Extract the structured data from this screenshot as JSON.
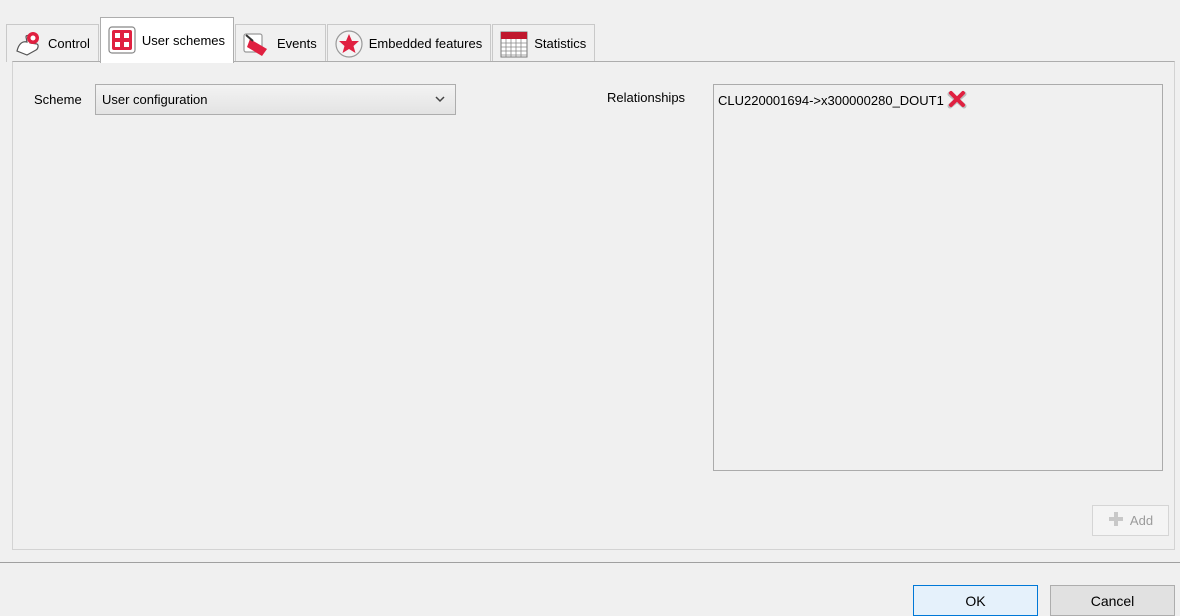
{
  "tabs": [
    {
      "label": "Control",
      "icon": "hand-pointer-icon",
      "active": false
    },
    {
      "label": "User schemes",
      "icon": "user-schemes-icon",
      "active": true
    },
    {
      "label": "Events",
      "icon": "events-icon",
      "active": false
    },
    {
      "label": "Embedded features",
      "icon": "star-badge-icon",
      "active": false
    },
    {
      "label": "Statistics",
      "icon": "calendar-grid-icon",
      "active": false
    }
  ],
  "scheme": {
    "label": "Scheme",
    "selected": "User configuration"
  },
  "relationships": {
    "label": "Relationships",
    "items": [
      {
        "text": "CLU220001694->x300000280_DOUT1",
        "icon": "delete-x-icon"
      }
    ],
    "add_label": "Add",
    "add_icon": "plus-icon"
  },
  "footer": {
    "ok_label": "OK",
    "cancel_label": "Cancel"
  },
  "colors": {
    "accent": "#0078d7",
    "icon_red": "#e02040",
    "window_bg": "#f0f0f0"
  }
}
